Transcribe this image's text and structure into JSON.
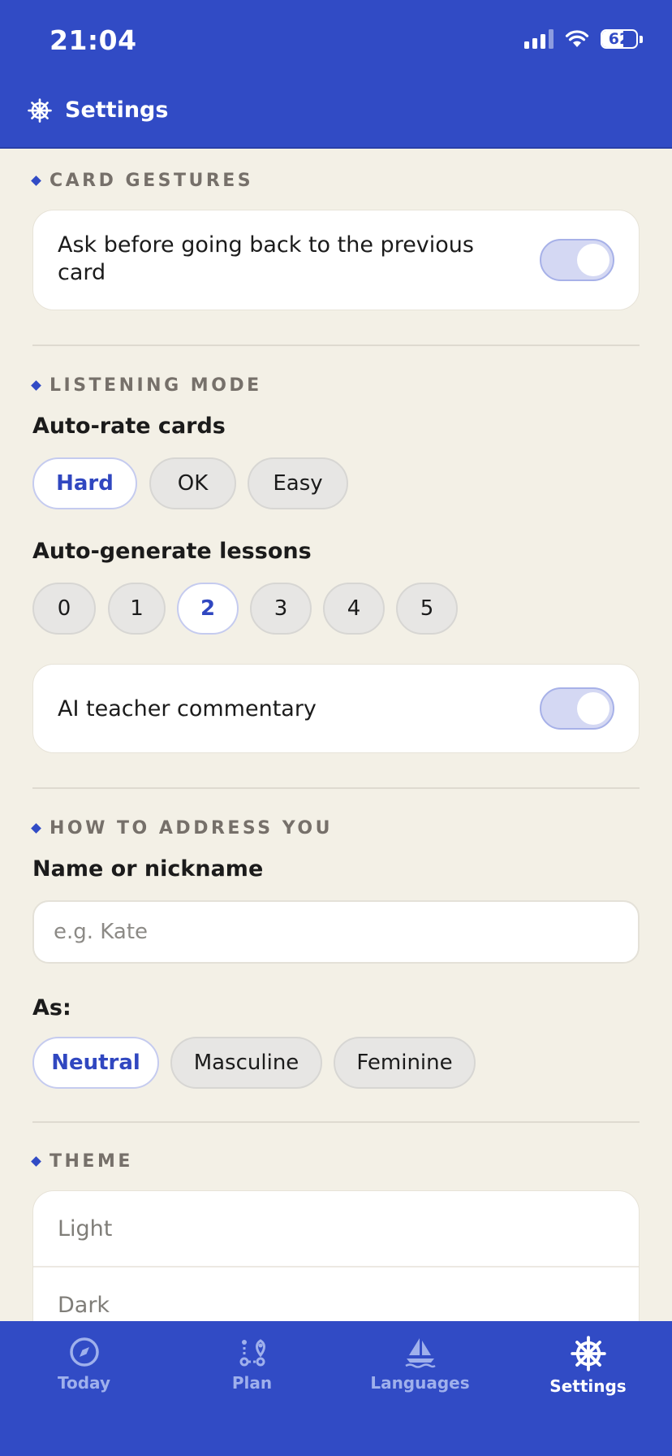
{
  "status": {
    "time": "21:04",
    "battery": "62",
    "battery_level": 0.62
  },
  "header": {
    "title": "Settings",
    "icon": "ship-wheel-icon"
  },
  "sections": {
    "card_gestures": {
      "heading": "CARD GESTURES",
      "toggle_label": "Ask before going back to the previous card",
      "toggle_on": true
    },
    "listening_mode": {
      "heading": "LISTENING MODE",
      "auto_rate_label": "Auto-rate cards",
      "auto_rate_options": [
        "Hard",
        "OK",
        "Easy"
      ],
      "auto_rate_selected": "Hard",
      "auto_generate_label": "Auto-generate lessons",
      "auto_generate_options": [
        "0",
        "1",
        "2",
        "3",
        "4",
        "5"
      ],
      "auto_generate_selected": "2",
      "commentary_label": "AI teacher commentary",
      "commentary_on": true
    },
    "address": {
      "heading": "HOW TO ADDRESS YOU",
      "name_label": "Name or nickname",
      "name_value": "",
      "name_placeholder": "e.g. Kate",
      "as_label": "As:",
      "as_options": [
        "Neutral",
        "Masculine",
        "Feminine"
      ],
      "as_selected": "Neutral"
    },
    "theme": {
      "heading": "THEME",
      "options": [
        "Light",
        "Dark"
      ]
    }
  },
  "tabbar": {
    "tabs": [
      {
        "label": "Today",
        "icon": "compass-icon",
        "active": false
      },
      {
        "label": "Plan",
        "icon": "route-icon",
        "active": false
      },
      {
        "label": "Languages",
        "icon": "sailboat-icon",
        "active": false
      },
      {
        "label": "Settings",
        "icon": "ship-wheel-icon",
        "active": true
      }
    ]
  },
  "colors": {
    "primary": "#314bc5",
    "background": "#f3f0e6",
    "toggle_track": "#d4d8f3"
  }
}
